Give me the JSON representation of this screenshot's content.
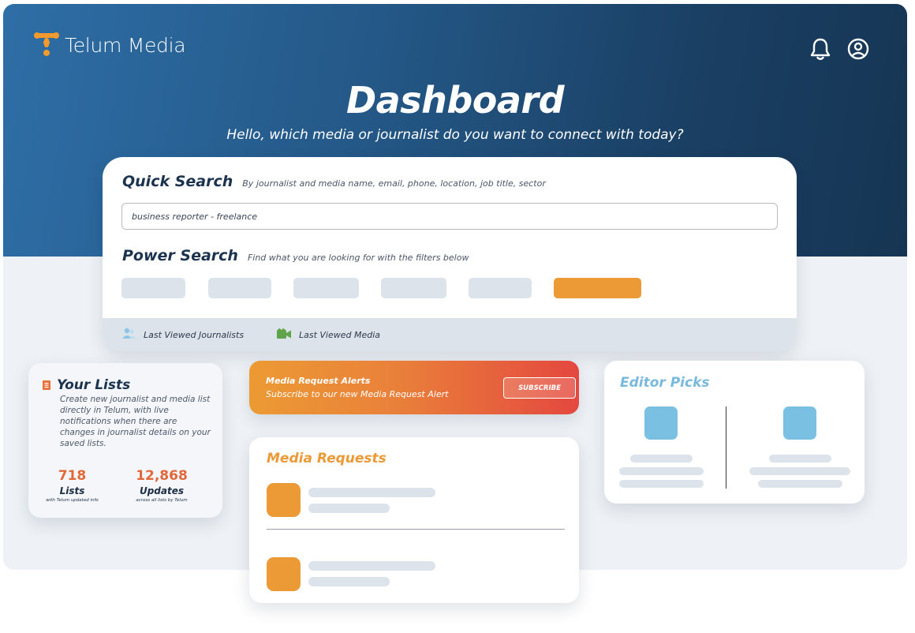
{
  "brand": {
    "name": "Telum Media",
    "accent": "#eb9a36",
    "navy": "#1c3350"
  },
  "header": {
    "icons": [
      "bell-icon",
      "user-circle-icon"
    ]
  },
  "hero": {
    "title": "Dashboard",
    "subtitle": "Hello, which media or journalist do you want to connect with today?"
  },
  "quick_search": {
    "title": "Quick Search",
    "hint": "By journalist and media name, email, phone, location, job title, sector",
    "value": "business reporter - freelance"
  },
  "power_search": {
    "title": "Power Search",
    "hint": "Find what you are looking for with the filters below"
  },
  "recent": {
    "journalists": "Last Viewed Journalists",
    "media": "Last Viewed Media"
  },
  "lists": {
    "title": "Your Lists",
    "description": "Create new journalist and media list directly in Telum, with live notifications when there are changes in journalist details on your saved lists.",
    "stats": [
      {
        "value": "718",
        "label": "Lists",
        "note": "with Telum updated info"
      },
      {
        "value": "12,868",
        "label": "Updates",
        "note": "across all lists by Telum"
      }
    ]
  },
  "alerts": {
    "title": "Media Request Alerts",
    "subtitle": "Subscribe to our new Media Request Alert",
    "button": "SUBSCRIBE"
  },
  "media_requests": {
    "title": "Media Requests"
  },
  "editor_picks": {
    "title": "Editor Picks"
  }
}
